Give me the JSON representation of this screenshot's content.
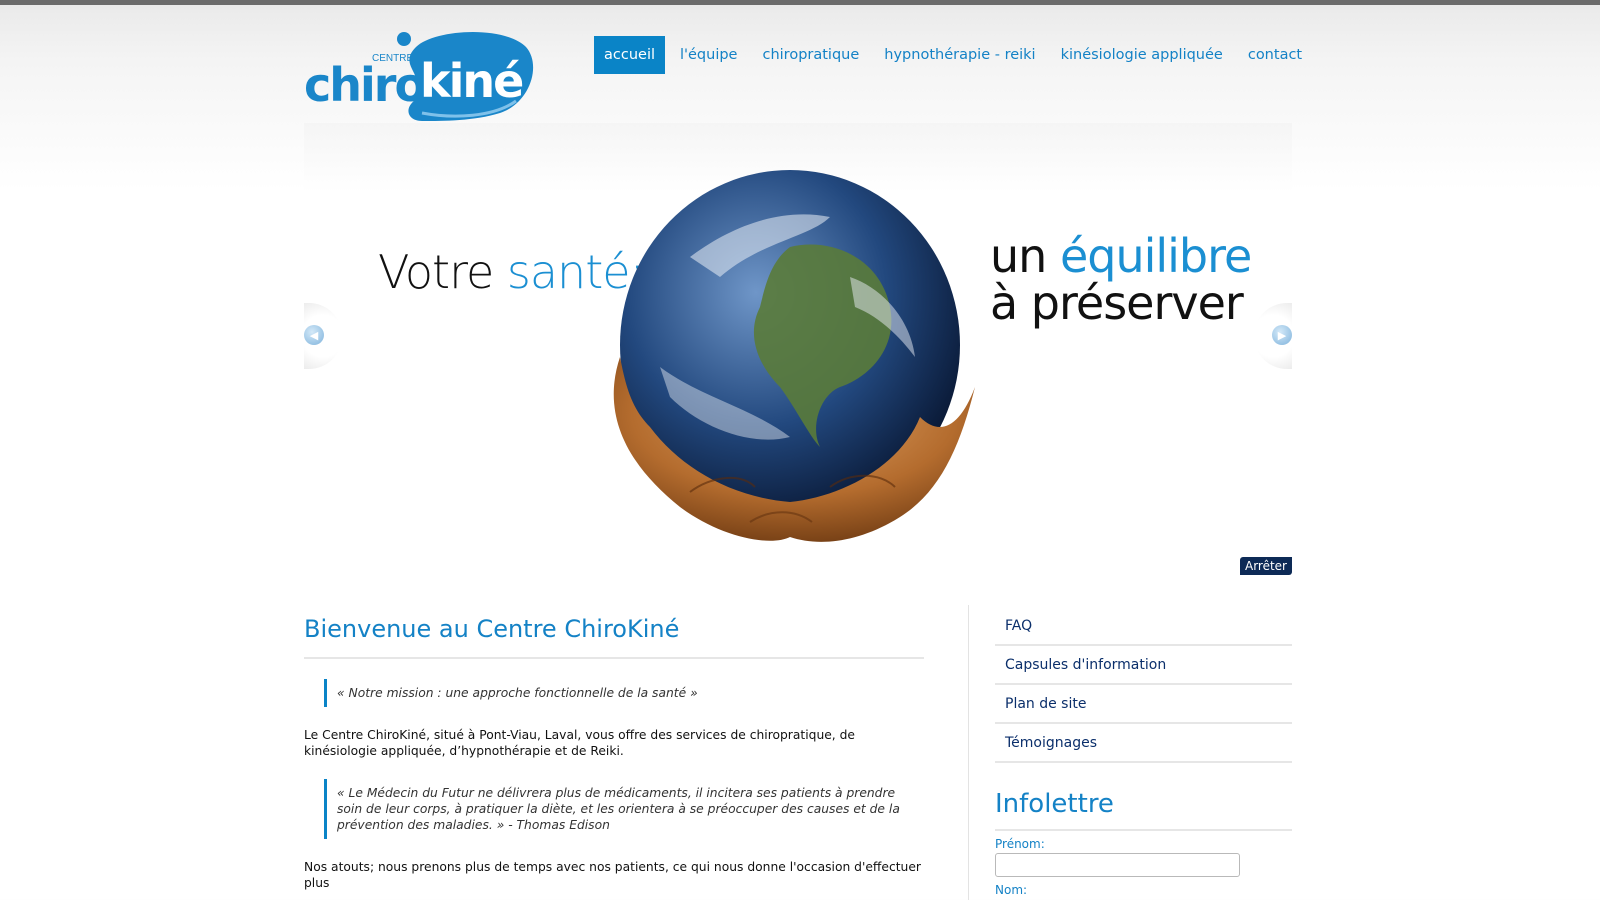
{
  "logo": {
    "small": "CENTRE",
    "chiro": "chiro",
    "kine": "kiné"
  },
  "nav": [
    {
      "label": "accueil"
    },
    {
      "label": "l'équipe"
    },
    {
      "label": "chiropratique"
    },
    {
      "label": "hypnothérapie - reiki"
    },
    {
      "label": "kinésiologie appliquée"
    },
    {
      "label": "contact"
    }
  ],
  "slider": {
    "left_plain": "Votre ",
    "left_hl": "santé:",
    "right_plain_1": "un ",
    "right_hl": "équilibre",
    "right_line_2": "à préserver",
    "stop_label": "Arrêter"
  },
  "main": {
    "title": "Bienvenue au Centre ChiroKiné",
    "quote1": "« Notre mission : une approche fonctionnelle de la santé »",
    "para1": "Le Centre ChiroKiné, situé à Pont-Viau, Laval, vous offre des services de chiropratique, de kinésiologie appliquée, d’hypnothérapie et de Reiki.",
    "quote2": "« Le Médecin du Futur ne délivrera plus de médicaments, il incitera ses patients à prendre soin de leur corps, à pratiquer la diète, et les orientera à se préoccuper des causes et de la prévention des maladies. » - Thomas Edison",
    "para2": "Nos atouts; nous prenons plus de temps avec nos patients, ce qui nous donne l'occasion d'effectuer plus"
  },
  "sidebar": {
    "links": [
      "FAQ",
      "Capsules d'information",
      "Plan de site",
      "Témoignages"
    ],
    "newsletter_title": "Infolettre",
    "field_first": "Prénom:",
    "field_last": "Nom:"
  },
  "colors": {
    "brand_blue": "#1482c6",
    "dark_navy": "#0d2a56"
  }
}
